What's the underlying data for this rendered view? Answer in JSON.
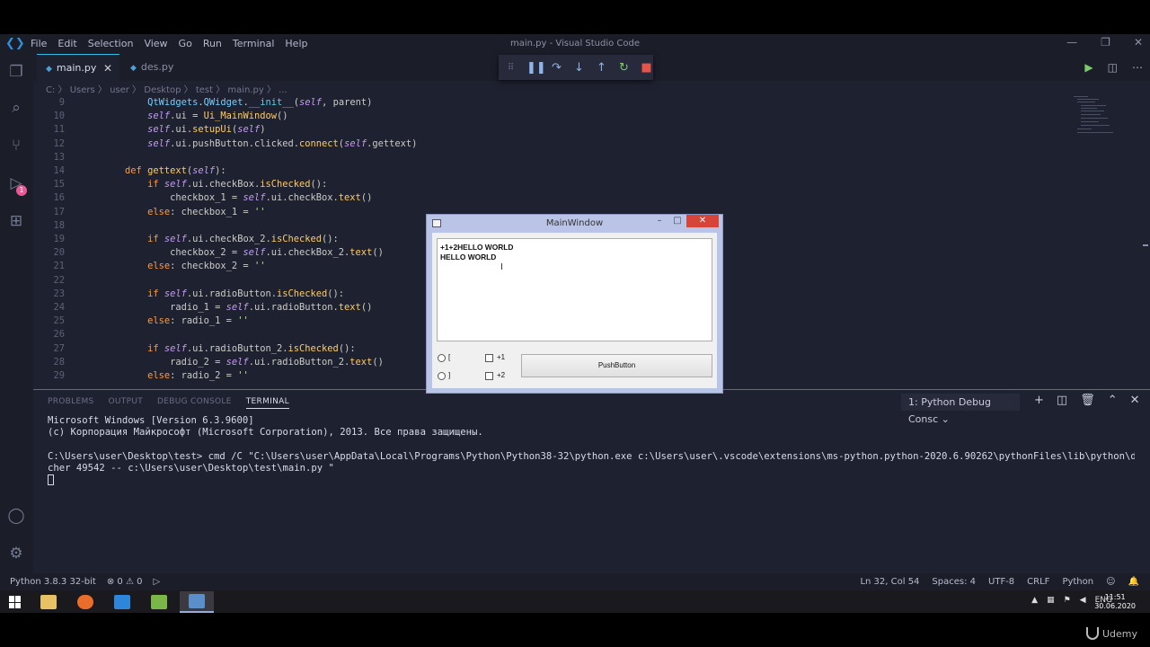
{
  "window": {
    "menu": [
      "File",
      "Edit",
      "Selection",
      "View",
      "Go",
      "Run",
      "Terminal",
      "Help"
    ],
    "title": "main.py - Visual Studio Code",
    "controls": [
      "—",
      "❐",
      "✕"
    ]
  },
  "tabs": [
    {
      "label": "main.py",
      "active": true
    },
    {
      "label": "des.py",
      "active": false
    }
  ],
  "breadcrumb": "C: 〉 Users 〉 user 〉 Desktop 〉 test 〉 main.py 〉 ...",
  "activity_badge": "1",
  "code_lines": [
    {
      "n": "9",
      "indent": "            ",
      "parts": [
        [
          "c-cls",
          "QtWidgets"
        ],
        [
          "c-txt",
          "."
        ],
        [
          "c-cls",
          "QWidget"
        ],
        [
          "c-txt",
          "."
        ],
        [
          "c-dunder",
          "__init__"
        ],
        [
          "c-txt",
          "("
        ],
        [
          "c-self",
          "self"
        ],
        [
          "c-txt",
          ", parent)"
        ]
      ]
    },
    {
      "n": "10",
      "indent": "            ",
      "parts": [
        [
          "c-self",
          "self"
        ],
        [
          "c-txt",
          ".ui = "
        ],
        [
          "c-fn",
          "Ui_MainWindow"
        ],
        [
          "c-txt",
          "()"
        ]
      ]
    },
    {
      "n": "11",
      "indent": "            ",
      "parts": [
        [
          "c-self",
          "self"
        ],
        [
          "c-txt",
          ".ui."
        ],
        [
          "c-fn",
          "setupUi"
        ],
        [
          "c-txt",
          "("
        ],
        [
          "c-self",
          "self"
        ],
        [
          "c-txt",
          ")"
        ]
      ]
    },
    {
      "n": "12",
      "indent": "            ",
      "parts": [
        [
          "c-self",
          "self"
        ],
        [
          "c-txt",
          ".ui.pushButton.clicked."
        ],
        [
          "c-fn",
          "connect"
        ],
        [
          "c-txt",
          "("
        ],
        [
          "c-self",
          "self"
        ],
        [
          "c-txt",
          ".gettext)"
        ]
      ]
    },
    {
      "n": "13",
      "indent": "",
      "parts": []
    },
    {
      "n": "14",
      "indent": "        ",
      "parts": [
        [
          "c-def",
          "def "
        ],
        [
          "c-fn",
          "gettext"
        ],
        [
          "c-txt",
          "("
        ],
        [
          "c-self",
          "self"
        ],
        [
          "c-txt",
          "):"
        ]
      ]
    },
    {
      "n": "15",
      "indent": "            ",
      "parts": [
        [
          "c-kw",
          "if "
        ],
        [
          "c-self",
          "self"
        ],
        [
          "c-txt",
          ".ui.checkBox."
        ],
        [
          "c-fn",
          "isChecked"
        ],
        [
          "c-txt",
          "():"
        ]
      ]
    },
    {
      "n": "16",
      "indent": "                ",
      "parts": [
        [
          "c-txt",
          "checkbox_1 = "
        ],
        [
          "c-self",
          "self"
        ],
        [
          "c-txt",
          ".ui.checkBox."
        ],
        [
          "c-fn",
          "text"
        ],
        [
          "c-txt",
          "()"
        ]
      ]
    },
    {
      "n": "17",
      "indent": "            ",
      "parts": [
        [
          "c-kw",
          "else"
        ],
        [
          "c-txt",
          ": checkbox_1 = "
        ],
        [
          "c-str",
          "''"
        ]
      ]
    },
    {
      "n": "18",
      "indent": "",
      "parts": []
    },
    {
      "n": "19",
      "indent": "            ",
      "parts": [
        [
          "c-kw",
          "if "
        ],
        [
          "c-self",
          "self"
        ],
        [
          "c-txt",
          ".ui.checkBox_2."
        ],
        [
          "c-fn",
          "isChecked"
        ],
        [
          "c-txt",
          "():"
        ]
      ]
    },
    {
      "n": "20",
      "indent": "                ",
      "parts": [
        [
          "c-txt",
          "checkbox_2 = "
        ],
        [
          "c-self",
          "self"
        ],
        [
          "c-txt",
          ".ui.checkBox_2."
        ],
        [
          "c-fn",
          "text"
        ],
        [
          "c-txt",
          "()"
        ]
      ]
    },
    {
      "n": "21",
      "indent": "            ",
      "parts": [
        [
          "c-kw",
          "else"
        ],
        [
          "c-txt",
          ": checkbox_2 = "
        ],
        [
          "c-str",
          "''"
        ]
      ]
    },
    {
      "n": "22",
      "indent": "",
      "parts": []
    },
    {
      "n": "23",
      "indent": "            ",
      "parts": [
        [
          "c-kw",
          "if "
        ],
        [
          "c-self",
          "self"
        ],
        [
          "c-txt",
          ".ui.radioButton."
        ],
        [
          "c-fn",
          "isChecked"
        ],
        [
          "c-txt",
          "():"
        ]
      ]
    },
    {
      "n": "24",
      "indent": "                ",
      "parts": [
        [
          "c-txt",
          "radio_1 = "
        ],
        [
          "c-self",
          "self"
        ],
        [
          "c-txt",
          ".ui.radioButton."
        ],
        [
          "c-fn",
          "text"
        ],
        [
          "c-txt",
          "()"
        ]
      ]
    },
    {
      "n": "25",
      "indent": "            ",
      "parts": [
        [
          "c-kw",
          "else"
        ],
        [
          "c-txt",
          ": radio_1 = "
        ],
        [
          "c-str",
          "''"
        ]
      ]
    },
    {
      "n": "26",
      "indent": "",
      "parts": []
    },
    {
      "n": "27",
      "indent": "            ",
      "parts": [
        [
          "c-kw",
          "if "
        ],
        [
          "c-self",
          "self"
        ],
        [
          "c-txt",
          ".ui.radioButton_2."
        ],
        [
          "c-fn",
          "isChecked"
        ],
        [
          "c-txt",
          "():"
        ]
      ]
    },
    {
      "n": "28",
      "indent": "                ",
      "parts": [
        [
          "c-txt",
          "radio_2 = "
        ],
        [
          "c-self",
          "self"
        ],
        [
          "c-txt",
          ".ui.radioButton_2."
        ],
        [
          "c-fn",
          "text"
        ],
        [
          "c-txt",
          "()"
        ]
      ]
    },
    {
      "n": "29",
      "indent": "            ",
      "parts": [
        [
          "c-kw",
          "else"
        ],
        [
          "c-txt",
          ": radio_2 = "
        ],
        [
          "c-str",
          "''"
        ]
      ]
    }
  ],
  "panel": {
    "tabs": [
      "PROBLEMS",
      "OUTPUT",
      "DEBUG CONSOLE",
      "TERMINAL"
    ],
    "active_tab": "TERMINAL",
    "terminal_select": "1: Python Debug Consc ⌄",
    "terminal_lines": [
      "Microsoft Windows [Version 6.3.9600]",
      "(c) Корпорация Майкрософт (Microsoft Corporation), 2013. Все права защищены.",
      "",
      "C:\\Users\\user\\Desktop\\test> cmd /C \"C:\\Users\\user\\AppData\\Local\\Programs\\Python\\Python38-32\\python.exe c:\\Users\\user\\.vscode\\extensions\\ms-python.python-2020.6.90262\\pythonFiles\\lib\\python\\debugpy\\laun",
      "cher 49542 -- c:\\Users\\user\\Desktop\\test\\main.py \""
    ]
  },
  "status": {
    "python": "Python 3.8.3 32-bit",
    "problems": "⊗ 0 ⚠ 0",
    "position": "Ln 32, Col 54",
    "spaces": "Spaces: 4",
    "encoding": "UTF-8",
    "eol": "CRLF",
    "language": "Python"
  },
  "taskbar": {
    "lang": "ENG",
    "time": "11:51",
    "date": "30.06.2020"
  },
  "qt_window": {
    "title": "MainWindow",
    "text_lines": [
      "+1+2HELLO WORLD",
      "HELLO WORLD"
    ],
    "radio_1_label": "[",
    "radio_2_label": "]",
    "check_1_label": "+1",
    "check_2_label": "+2",
    "button_label": "PushButton"
  },
  "watermark": "Udemy"
}
